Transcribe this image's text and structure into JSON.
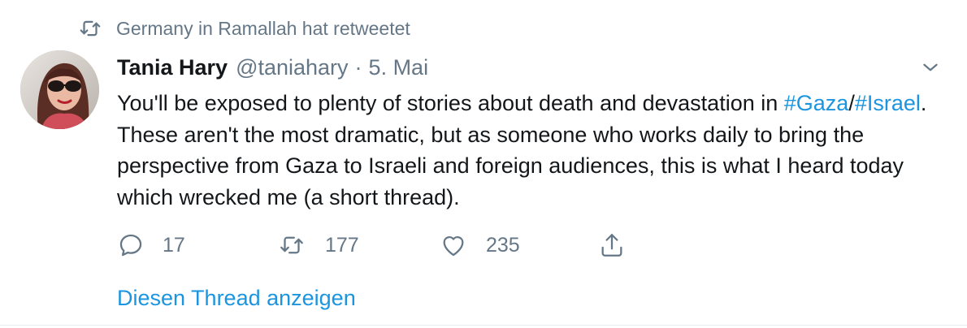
{
  "retweet_context": {
    "icon": "retweet-icon",
    "text": "Germany in Ramallah hat retweetet"
  },
  "tweet": {
    "author": {
      "name": "Tania Hary",
      "handle": "@taniahary",
      "separator": "·",
      "time": "5. Mai",
      "avatar_icon": "avatar-photo"
    },
    "text": {
      "line1": "You'll be exposed to plenty of stories about death and devastation in ",
      "hashtag1": "#Gaza",
      "slash": "/",
      "hashtag2": "#Israel",
      "rest": ". These aren't the most dramatic, but as someone who works daily to bring the perspective from Gaza to Israeli and foreign audiences, this is what I heard today which wrecked me (a short thread)."
    },
    "actions": {
      "reply": {
        "icon": "reply-icon",
        "count": "17"
      },
      "retweet": {
        "icon": "retweet-icon",
        "count": "177"
      },
      "like": {
        "icon": "heart-icon",
        "count": "235"
      },
      "share": {
        "icon": "share-icon"
      }
    },
    "show_thread_label": "Diesen Thread anzeigen"
  },
  "colors": {
    "link": "#1b95e0",
    "muted": "#657786",
    "text": "#14171a"
  }
}
